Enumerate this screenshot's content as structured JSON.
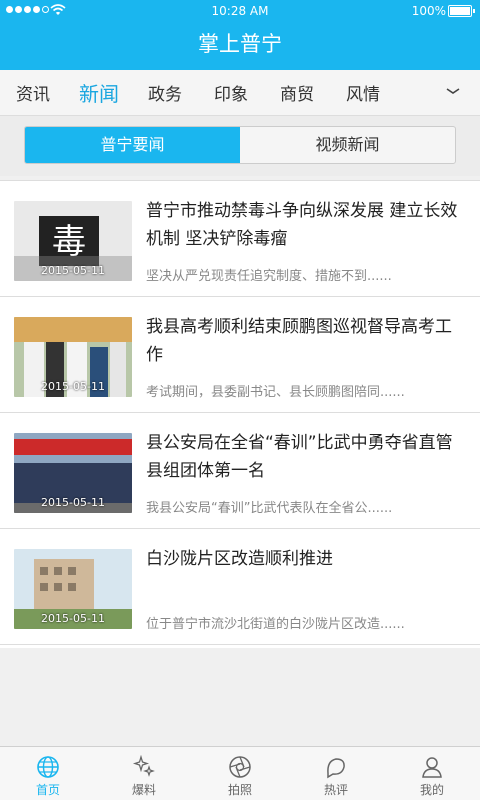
{
  "status_bar": {
    "time": "10:28 AM",
    "battery": "100%"
  },
  "app": {
    "title": "掌上普宁"
  },
  "categories": [
    {
      "label": "资讯"
    },
    {
      "label": "新闻",
      "active": true
    },
    {
      "label": "政务"
    },
    {
      "label": "印象"
    },
    {
      "label": "商贸"
    },
    {
      "label": "风情"
    }
  ],
  "tabs": [
    {
      "label": "普宁要闻",
      "active": true
    },
    {
      "label": "视频新闻"
    }
  ],
  "news": [
    {
      "title": "普宁市推动禁毒斗争向纵深发展 建立长效机制 坚决铲除毒瘤",
      "summary": "坚决从严兑现责任追究制度、措施不到......",
      "date": "2015-05-11"
    },
    {
      "title": "我县高考顺利结束顾鹏图巡视督导高考工作",
      "summary": "考试期间，县委副书记、县长顾鹏图陪同......",
      "date": "2015-05-11"
    },
    {
      "title": "县公安局在全省“春训”比武中勇夺省直管县组团体第一名",
      "summary": "我县公安局“春训”比武代表队在全省公......",
      "date": "2015-05-11"
    },
    {
      "title": "白沙陇片区改造顺利推进",
      "summary": "位于普宁市流沙北街道的白沙陇片区改造......",
      "date": "2015-05-11"
    }
  ],
  "footer": [
    {
      "label": "首页",
      "icon": "globe-icon",
      "active": true
    },
    {
      "label": "爆料",
      "icon": "sparkle-icon"
    },
    {
      "label": "拍照",
      "icon": "camera-aperture-icon"
    },
    {
      "label": "热评",
      "icon": "comment-icon"
    },
    {
      "label": "我的",
      "icon": "user-icon"
    }
  ],
  "colors": {
    "accent": "#1ab6ef",
    "active_nav": "#1aa6e0"
  }
}
